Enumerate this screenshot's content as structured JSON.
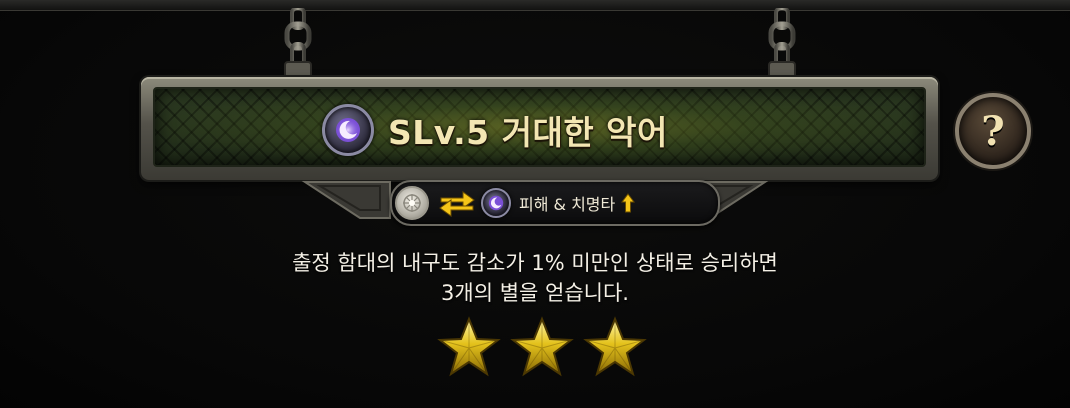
{
  "stage": {
    "title": "SLv.5 거대한 악어",
    "title_icon": "purple-crescent-orb-icon"
  },
  "advantage": {
    "from_icon": "white-orb-icon",
    "swap_icon": "swap-arrows-icon",
    "to_icon": "purple-crescent-orb-icon",
    "label": "피해 & 치명타",
    "trend_icon": "up-arrow-icon"
  },
  "help": {
    "label": "?"
  },
  "condition": {
    "line1": "출정 함대의 내구도 감소가 1% 미만인 상태로 승리하면",
    "line2": "3개의 별을 얻습니다."
  },
  "rating": {
    "stars_earned": 3,
    "stars_total": 3
  },
  "colors": {
    "title_text": "#f3e6b3",
    "star_gold": "#e4c21c",
    "arrow_yellow": "#f5c518",
    "plate_green": "#3b4a24"
  }
}
